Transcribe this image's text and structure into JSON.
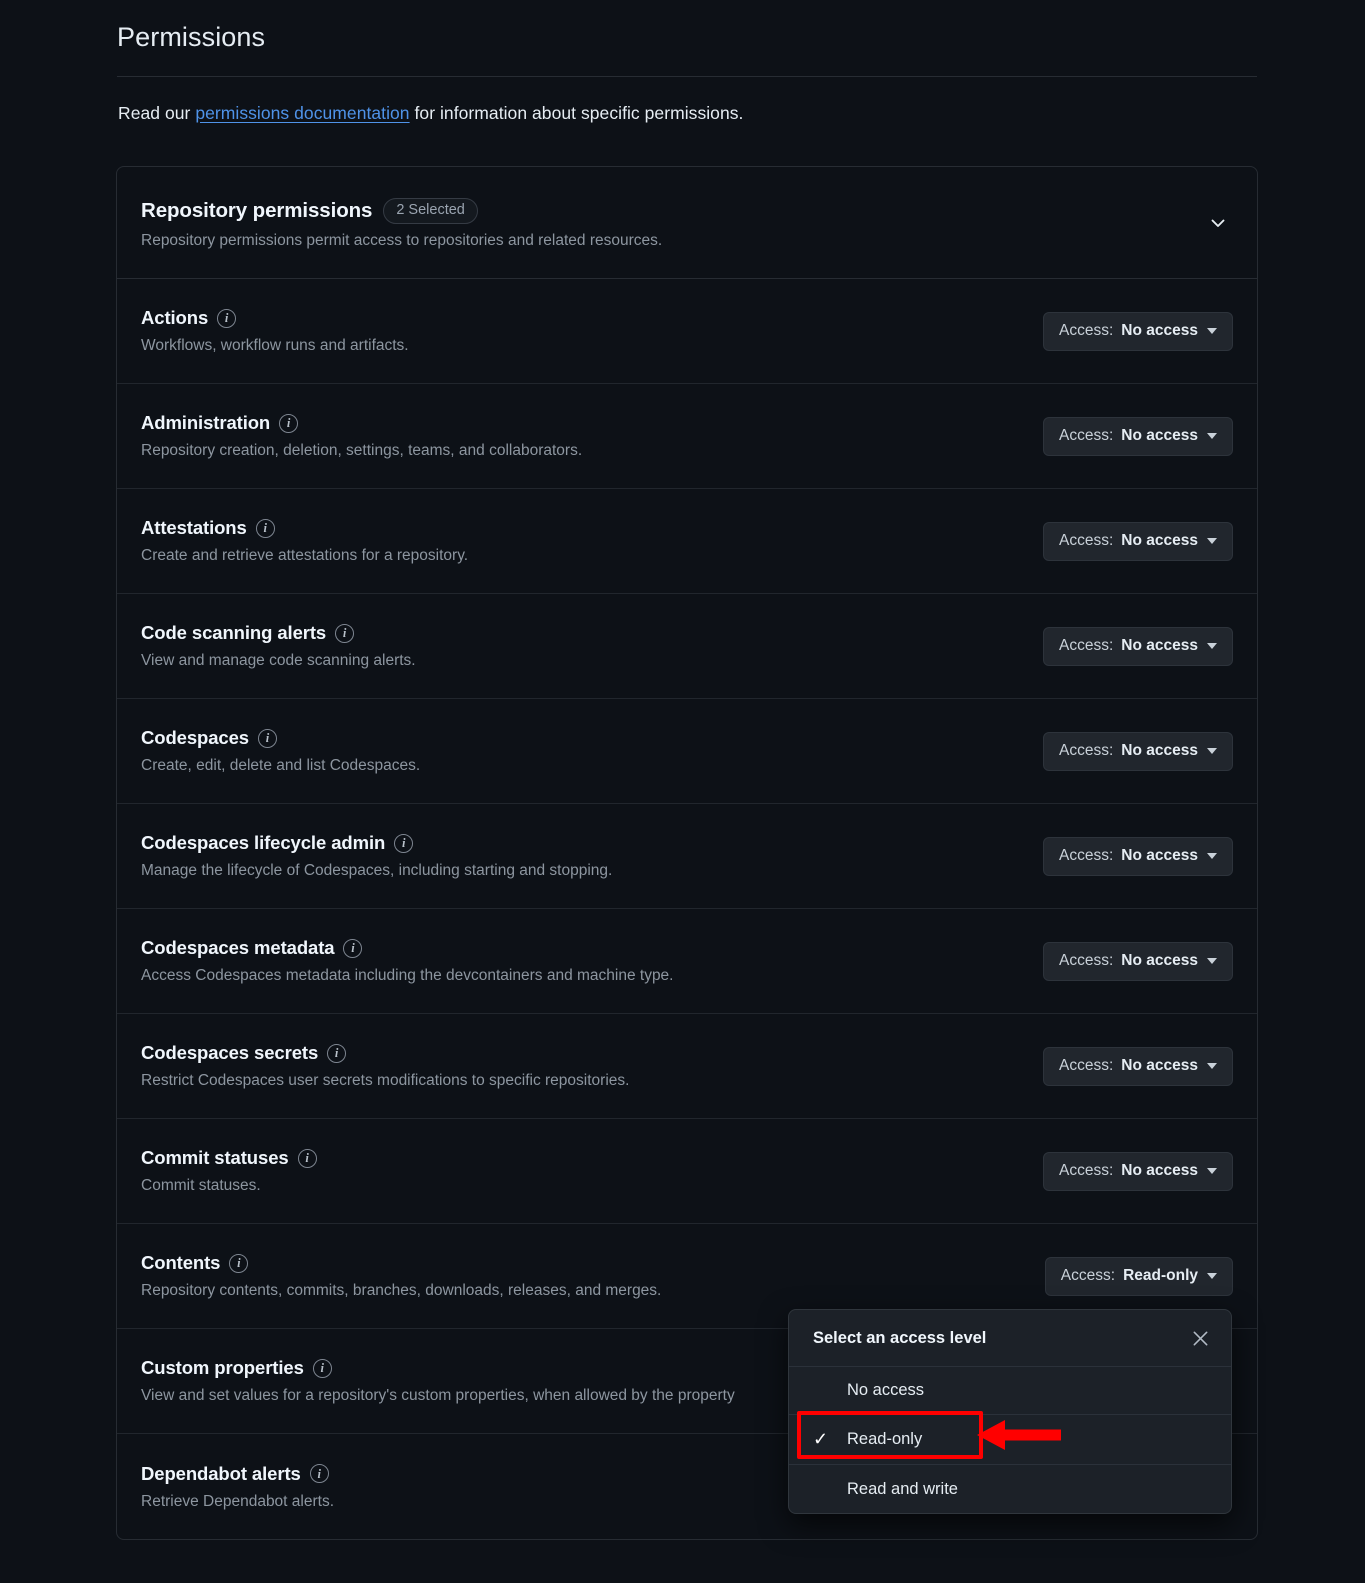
{
  "page": {
    "title": "Permissions",
    "intro_prefix": "Read our ",
    "intro_link": "permissions documentation",
    "intro_suffix": " for information about specific permissions."
  },
  "card": {
    "header_title": "Repository permissions",
    "badge": "2 Selected",
    "header_sub": "Repository permissions permit access to repositories and related resources.",
    "collapse_icon": "chevron-down-icon"
  },
  "access_prefix": "Access: ",
  "permissions": [
    {
      "name": "Actions",
      "description": "Workflows, workflow runs and artifacts.",
      "access": "No access"
    },
    {
      "name": "Administration",
      "description": "Repository creation, deletion, settings, teams, and collaborators.",
      "access": "No access"
    },
    {
      "name": "Attestations",
      "description": "Create and retrieve attestations for a repository.",
      "access": "No access"
    },
    {
      "name": "Code scanning alerts",
      "description": "View and manage code scanning alerts.",
      "access": "No access"
    },
    {
      "name": "Codespaces",
      "description": "Create, edit, delete and list Codespaces.",
      "access": "No access"
    },
    {
      "name": "Codespaces lifecycle admin",
      "description": "Manage the lifecycle of Codespaces, including starting and stopping.",
      "access": "No access"
    },
    {
      "name": "Codespaces metadata",
      "description": "Access Codespaces metadata including the devcontainers and machine type.",
      "access": "No access"
    },
    {
      "name": "Codespaces secrets",
      "description": "Restrict Codespaces user secrets modifications to specific repositories.",
      "access": "No access"
    },
    {
      "name": "Commit statuses",
      "description": "Commit statuses.",
      "access": "No access"
    },
    {
      "name": "Contents",
      "description": "Repository contents, commits, branches, downloads, releases, and merges.",
      "access": "Read-only"
    },
    {
      "name": "Custom properties",
      "description": "View and set values for a repository's custom properties, when allowed by the property",
      "access": ""
    },
    {
      "name": "Dependabot alerts",
      "description": "Retrieve Dependabot alerts.",
      "access": ""
    }
  ],
  "popup": {
    "title": "Select an access level",
    "close_icon": "close-icon",
    "options": [
      {
        "label": "No access",
        "selected": false
      },
      {
        "label": "Read-only",
        "selected": true
      },
      {
        "label": "Read and write",
        "selected": false
      }
    ],
    "check_glyph": "✓"
  },
  "annotation": {
    "highlight_color": "#ff0000",
    "arrow_color": "#ff0000",
    "target": "Read-only"
  }
}
